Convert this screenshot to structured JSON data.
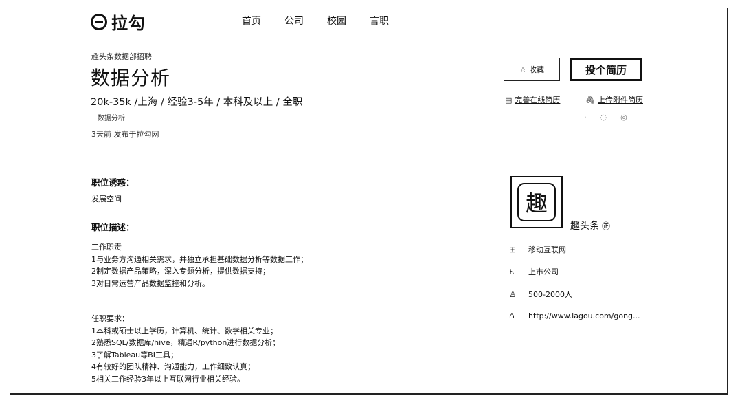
{
  "header": {
    "brand": "拉勾",
    "nav": [
      "首页",
      "公司",
      "校园",
      "言职"
    ]
  },
  "job": {
    "company_line": "趣头条数据部招聘",
    "title": "数据分析",
    "meta": "20k-35k /上海 / 经验3-5年 / 本科及以上 / 全职",
    "tag": "数据分析",
    "published": "3天前  发布于拉勾网"
  },
  "actions": {
    "favorite_label": "收藏",
    "apply_label": "投个简历",
    "online_resume_label": "完善在线简历",
    "attach_resume_label": "上传附件简历"
  },
  "details": {
    "advantage_heading": "职位诱惑：",
    "advantage_text": "发展空间",
    "desc_heading": "职位描述：",
    "duties_lines": [
      "工作职责",
      "1与业务方沟通相关需求，并独立承担基础数据分析等数据工作；",
      "2制定数据产品策略，深入专题分析，提供数据支持；",
      "3对日常运营产品数据监控和分析。"
    ],
    "req_lines": [
      "任职要求：",
      "1本科或硕士以上学历，计算机、统计、数学相关专业；",
      "2熟悉SQL/数据库/hive，精通R/python进行数据分析；",
      "3了解Tableau等BI工具；",
      "4有较好的团队精神、沟通能力，工作细致认真；",
      "5相关工作经验3年以上互联网行业相关经验。"
    ]
  },
  "company": {
    "logo_char": "趣",
    "name": "趣头条",
    "field": "移动互联网",
    "stage": "上市公司",
    "size": "500-2000人",
    "site": "http://www.lagou.com/gong..."
  }
}
